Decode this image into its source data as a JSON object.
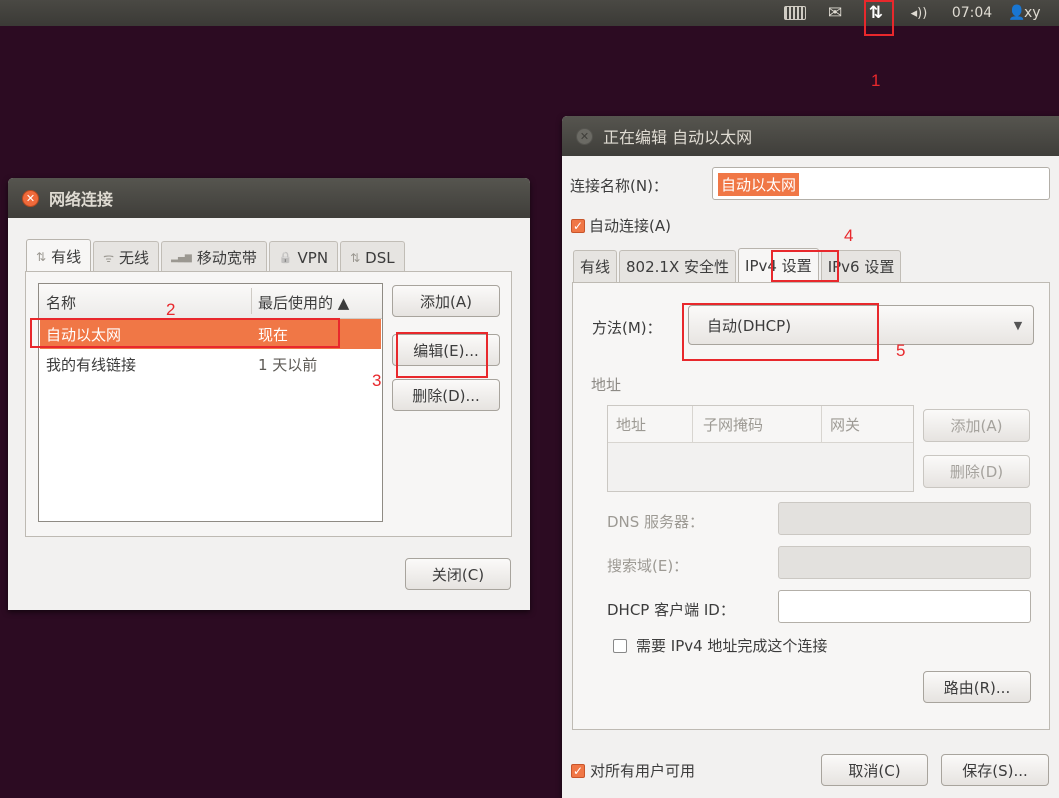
{
  "topbar": {
    "keyboard_icon": "keyboard-icon",
    "mail_icon": "envelope-icon",
    "network_icon_glyph": "⇅",
    "sound_icon_glyph": "◂))",
    "clock": "07:04",
    "user_icon_glyph": "👤",
    "username": "xy"
  },
  "annotations": [
    "1",
    "2",
    "3",
    "4",
    "5"
  ],
  "net_window": {
    "title": "网络连接",
    "tabs": [
      {
        "icon": "⇅",
        "label": "有线",
        "active": true
      },
      {
        "icon": "ᯤ",
        "label": "无线"
      },
      {
        "icon": "▂▄▆",
        "label": "移动宽带"
      },
      {
        "icon": "🔒",
        "label": "VPN"
      },
      {
        "icon": "⇅",
        "label": "DSL"
      }
    ],
    "columns": [
      "名称",
      "最后使用的 ▲"
    ],
    "rows": [
      {
        "name": "自动以太网",
        "last_used": "现在",
        "selected": true
      },
      {
        "name": "我的有线链接",
        "last_used": "1 天以前"
      }
    ],
    "buttons": {
      "add": "添加(A)",
      "edit": "编辑(E)...",
      "delete": "删除(D)..."
    },
    "close": "关闭(C)"
  },
  "edit_window": {
    "title": "正在编辑 自动以太网",
    "conn_name_label": "连接名称(N)：",
    "conn_name_value": "自动以太网",
    "auto_connect": "自动连接(A)",
    "tabs": [
      "有线",
      "802.1X 安全性",
      "IPv4 设置",
      "IPv6 设置"
    ],
    "active_tab": "IPv4 设置",
    "method_label": "方法(M)：",
    "method_value": "自动(DHCP)",
    "address_section": "地址",
    "address_columns": [
      "地址",
      "子网掩码",
      "网关"
    ],
    "address_add": "添加(A)",
    "address_delete": "删除(D)",
    "dns_label": "DNS 服务器：",
    "search_label": "搜索域(E)：",
    "dhcp_label": "DHCP 客户端 ID：",
    "require_ipv4": "需要 IPv4 地址完成这个连接",
    "routes": "路由(R)...",
    "all_users": "对所有用户可用",
    "cancel": "取消(C)",
    "save": "保存(S)..."
  }
}
